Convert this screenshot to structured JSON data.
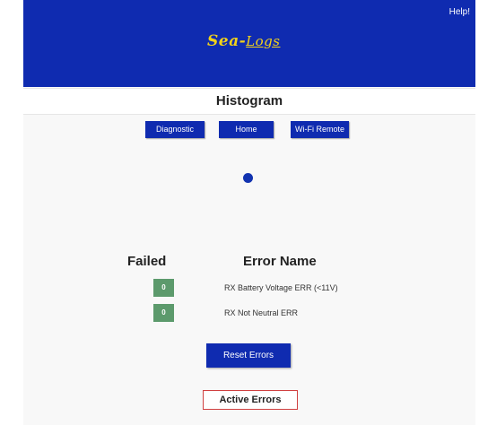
{
  "header": {
    "help_label": "Help!",
    "logo_part1": "Sea-",
    "logo_part2": "Logs",
    "background_color": "#0f2bb0",
    "logo_color": "#f2d21a"
  },
  "page": {
    "title": "Histogram"
  },
  "nav": {
    "diagnostic_label": "Diagnostic",
    "home_label": "Home",
    "wifi_remote_label": "Wi-Fi Remote"
  },
  "errors_table": {
    "failed_header": "Failed",
    "name_header": "Error Name",
    "rows": [
      {
        "count": "0",
        "name": "RX Battery Voltage ERR (<11V)"
      },
      {
        "count": "0",
        "name": "RX Not Neutral ERR"
      }
    ],
    "badge_color": "#5c9a6c"
  },
  "actions": {
    "reset_label": "Reset Errors",
    "active_errors_label": "Active Errors"
  },
  "icons": {
    "loading": "loading-spinner-icon"
  }
}
